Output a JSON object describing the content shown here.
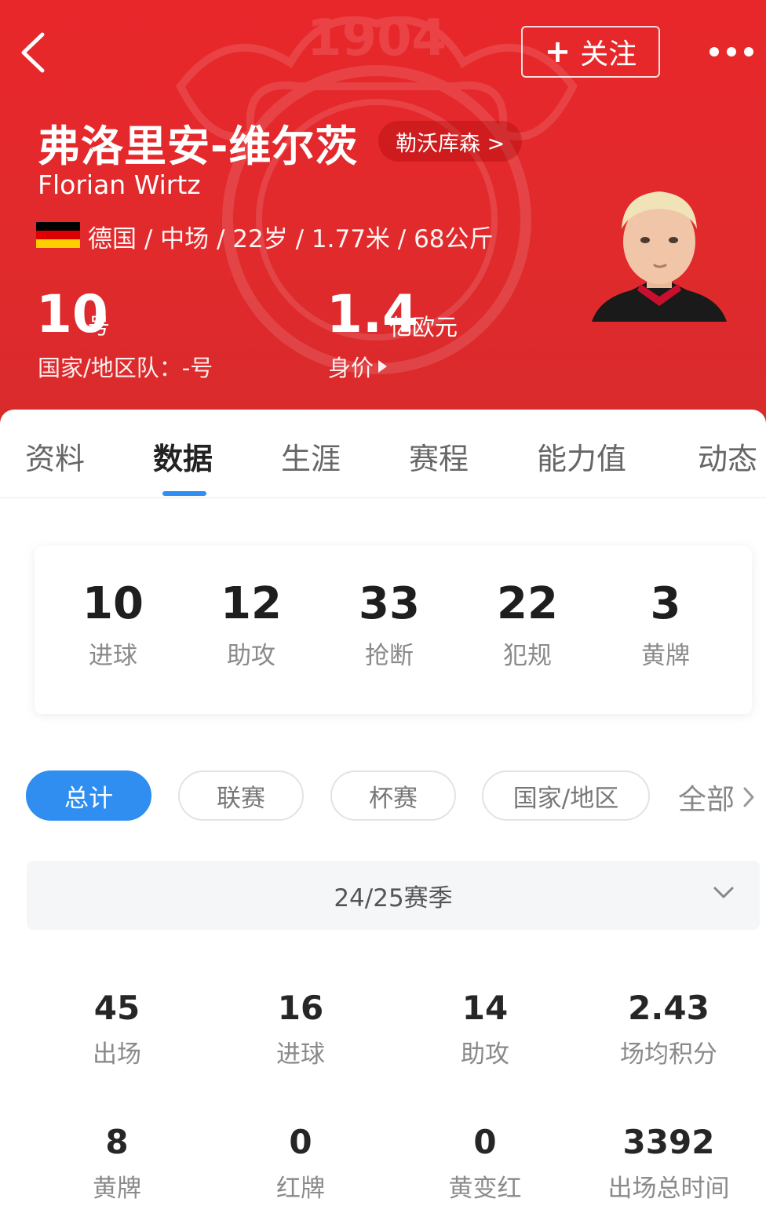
{
  "colors": {
    "header_red": "#e02a2c",
    "accent_blue": "#2f8ef0"
  },
  "header": {
    "back_icon": "chevron-left-icon",
    "follow_label": "+ 关注",
    "follow_text": "关注",
    "more_icon": "more-dots-icon",
    "crest_text": "1904",
    "name_cn": "弗洛里安-维尔茨",
    "team": "勒沃库森 >",
    "name_en": "Florian Wirtz",
    "nationality_flag": "germany-flag-icon",
    "info": "德国 / 中场 / 22岁 / 1.77米 / 68公斤",
    "shirt_number": "10",
    "shirt_unit": "号",
    "national_team": "国家/地区队：-号",
    "market_value": "1.4",
    "market_value_unit": "亿欧元",
    "market_value_label": "身价"
  },
  "tabs": [
    {
      "label": "资料"
    },
    {
      "label": "数据"
    },
    {
      "label": "生涯"
    },
    {
      "label": "赛程"
    },
    {
      "label": "能力值"
    },
    {
      "label": "动态"
    }
  ],
  "active_tab": "数据",
  "summary": [
    {
      "value": "10",
      "label": "进球"
    },
    {
      "value": "12",
      "label": "助攻"
    },
    {
      "value": "33",
      "label": "抢断"
    },
    {
      "value": "22",
      "label": "犯规"
    },
    {
      "value": "3",
      "label": "黄牌"
    }
  ],
  "filters": [
    {
      "label": "总计",
      "active": true
    },
    {
      "label": "联赛",
      "active": false
    },
    {
      "label": "杯赛",
      "active": false
    },
    {
      "label": "国家/地区",
      "active": false
    }
  ],
  "filter_more": "全部",
  "season": "24/25赛季",
  "stats": [
    {
      "value": "45",
      "label": "出场"
    },
    {
      "value": "16",
      "label": "进球"
    },
    {
      "value": "14",
      "label": "助攻"
    },
    {
      "value": "2.43",
      "label": "场均积分"
    },
    {
      "value": "8",
      "label": "黄牌"
    },
    {
      "value": "0",
      "label": "红牌"
    },
    {
      "value": "0",
      "label": "黄变红"
    },
    {
      "value": "3392",
      "label": "出场总时间"
    }
  ]
}
